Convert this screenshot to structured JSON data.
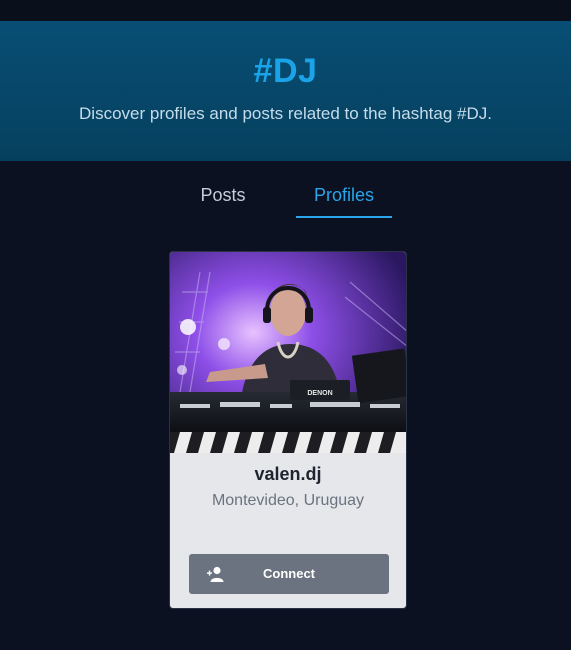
{
  "hero": {
    "title": "#DJ",
    "subtitle": "Discover profiles and posts related to the hashtag #DJ."
  },
  "tabs": [
    {
      "label": "Posts",
      "active": false
    },
    {
      "label": "Profiles",
      "active": true
    }
  ],
  "profile_card": {
    "username": "valen.dj",
    "location": "Montevideo, Uruguay",
    "connect_label": "Connect",
    "icon": "add-user-icon",
    "photo_mixer_brand": "DENON"
  },
  "colors": {
    "accent": "#2aa5ea",
    "hero_bg": "#06405f",
    "page_bg": "#0b1120",
    "button": "#6b7280"
  }
}
